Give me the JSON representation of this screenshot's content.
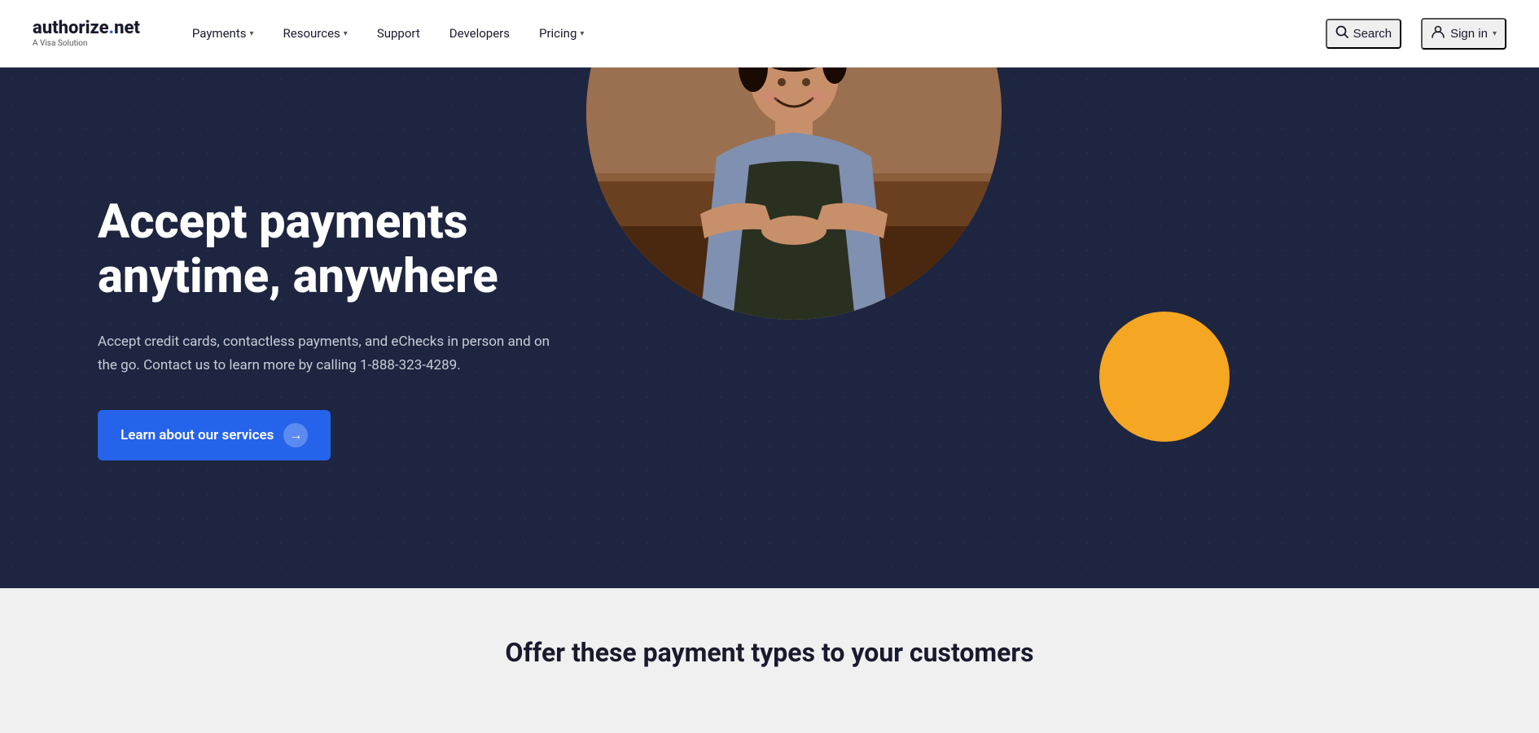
{
  "logo": {
    "brand": "authorize",
    "dot": ".",
    "tld": "net",
    "sub": "A Visa Solution"
  },
  "nav": {
    "items": [
      {
        "label": "Payments",
        "hasDropdown": true
      },
      {
        "label": "Resources",
        "hasDropdown": true
      },
      {
        "label": "Support",
        "hasDropdown": false
      },
      {
        "label": "Developers",
        "hasDropdown": false
      },
      {
        "label": "Pricing",
        "hasDropdown": true
      }
    ]
  },
  "topRight": {
    "searchLabel": "Search",
    "signinLabel": "Sign in"
  },
  "hero": {
    "title": "Accept payments anytime, anywhere",
    "description": "Accept credit cards, contactless payments, and eChecks in person and on the go. Contact us to learn more by calling 1-888-323-4289.",
    "ctaLabel": "Learn about our services"
  },
  "bottomSection": {
    "title": "Offer these payment types to your customers"
  }
}
